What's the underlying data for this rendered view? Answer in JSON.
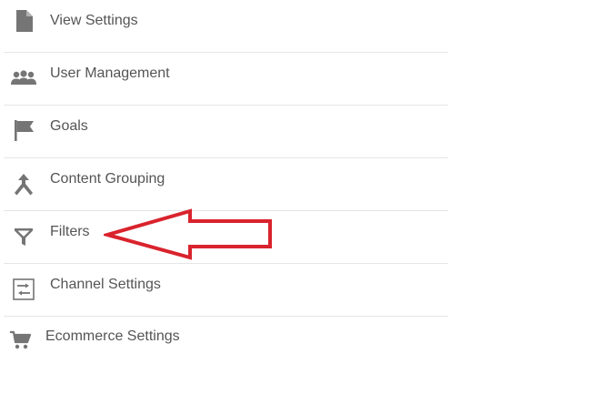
{
  "menu": {
    "items": [
      {
        "label": "View Settings",
        "icon": "document-icon"
      },
      {
        "label": "User Management",
        "icon": "users-icon"
      },
      {
        "label": "Goals",
        "icon": "flag-icon"
      },
      {
        "label": "Content Grouping",
        "icon": "merge-icon"
      },
      {
        "label": "Filters",
        "icon": "filter-icon"
      },
      {
        "label": "Channel Settings",
        "icon": "channel-settings-icon"
      },
      {
        "label": "Ecommerce Settings",
        "icon": "cart-icon"
      }
    ]
  },
  "annotation": {
    "color": "#d9232d",
    "target": "Filters"
  },
  "colors": {
    "icon": "#757575",
    "text": "#555555",
    "divider": "#e6e6e6"
  }
}
